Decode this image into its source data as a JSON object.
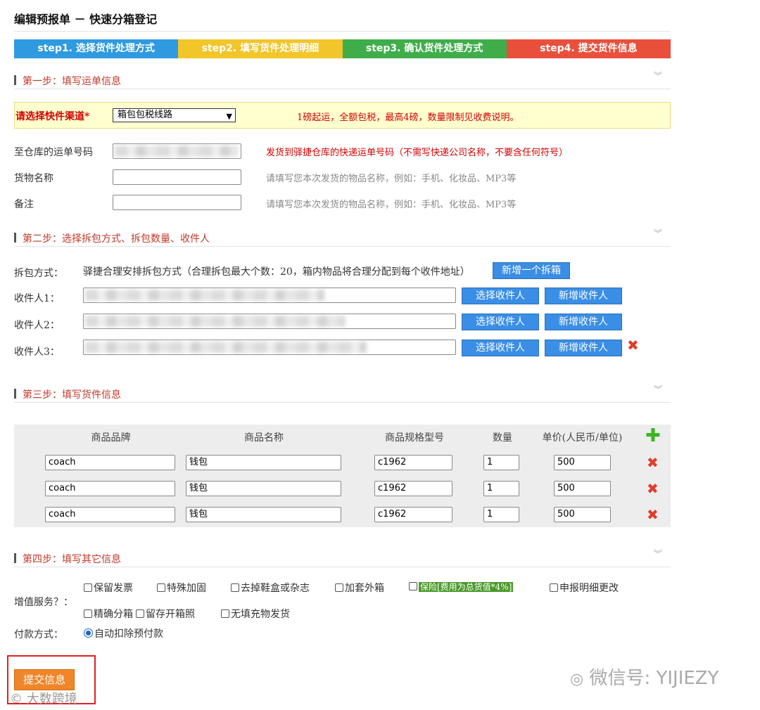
{
  "page_title": "编辑预报单  －  快速分箱登记",
  "steps": [
    {
      "label": "step1. 选择货件处理方式",
      "color": "#2f9ae0"
    },
    {
      "label": "step2. 填写货件处理明细",
      "color": "#f2c52a"
    },
    {
      "label": "step3. 确认货件处理方式",
      "color": "#3fae4a"
    },
    {
      "label": "step4. 提交货件信息",
      "color": "#e8503c"
    }
  ],
  "section1": {
    "title": "第一步：填写运单信息",
    "channel_label": "请选择快件渠道*",
    "channel_value": "箱包包税线路",
    "channel_note": "1磅起运，全额包税，最高4磅，数量限制见收费说明。",
    "waybill_label": "至仓库的运单号码",
    "waybill_hint": "发货到驿捷仓库的快递运单号码（不需写快递公司名称，不要含任何符号）",
    "goods_label": "货物名称",
    "goods_hint": "请填写您本次发货的物品名称，例如：手机、化妆品、MP3等",
    "remark_label": "备注",
    "remark_hint": "请填写您本次发货的物品名称，例如：手机、化妆品、MP3等"
  },
  "section2": {
    "title": "第二步：选择拆包方式、拆包数量、收件人",
    "split_label": "拆包方式：",
    "split_text": "驿捷合理安排拆包方式（合理拆包最大个数：20，箱内物品将合理分配到每个收件地址）",
    "add_box_label": "新增一个拆箱",
    "recipients": [
      {
        "label": "收件人1："
      },
      {
        "label": "收件人2："
      },
      {
        "label": "收件人3："
      }
    ],
    "select_recipient_label": "选择收件人",
    "new_recipient_label": "新增收件人"
  },
  "section3": {
    "title": "第三步：填写货件信息",
    "headers": [
      "商品品牌",
      "商品名称",
      "商品规格型号",
      "数量",
      "单价(人民币/单位)"
    ],
    "rows": [
      {
        "brand": "coach",
        "name": "钱包",
        "model": "c1962",
        "qty": "1",
        "price": "500"
      },
      {
        "brand": "coach",
        "name": "钱包",
        "model": "c1962",
        "qty": "1",
        "price": "500"
      },
      {
        "brand": "coach",
        "name": "钱包",
        "model": "c1962",
        "qty": "1",
        "price": "500"
      }
    ]
  },
  "section4": {
    "title": "第四步：填写其它信息",
    "value_added_label": "增值服务？：",
    "options_row1": [
      "保留发票",
      "特殊加固",
      "去掉鞋盒或杂志",
      "加套外箱",
      "保险[费用为总货值*4%]",
      "申报明细更改"
    ],
    "options_row2": [
      "精确分箱",
      "留存开箱照",
      "无填充物发货"
    ],
    "payment_label": "付款方式：",
    "payment_option": "自动扣除预付款"
  },
  "submit_label": "提交信息",
  "watermark_right": "微信号: YIJIEZY",
  "watermark_left": "大数跨境"
}
